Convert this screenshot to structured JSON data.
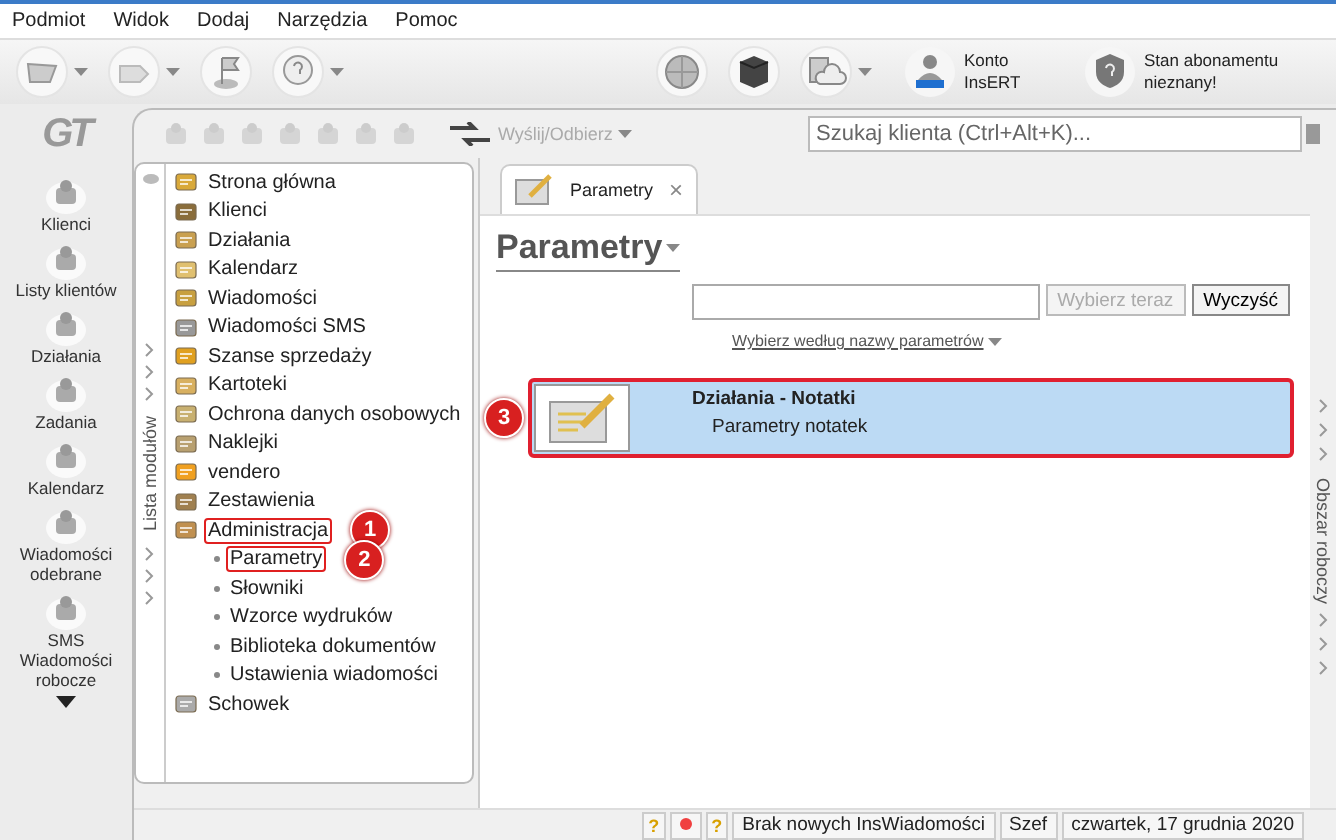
{
  "menu": [
    "Podmiot",
    "Widok",
    "Dodaj",
    "Narzędzia",
    "Pomoc"
  ],
  "account": {
    "label": "Konto InsERT"
  },
  "subscription": {
    "label": "Stan abonamentu nieznany!"
  },
  "logo": "GT",
  "nav": [
    {
      "label": "Klienci"
    },
    {
      "label": "Listy klientów"
    },
    {
      "label": "Działania"
    },
    {
      "label": "Zadania"
    },
    {
      "label": "Kalendarz"
    },
    {
      "label": "Wiadomości odebrane"
    },
    {
      "label": "SMS Wiadomości robocze"
    }
  ],
  "toolbar": {
    "send_receive": "Wyślij/Odbierz",
    "search": {
      "placeholder": "Szukaj klienta (Ctrl+Alt+K)..."
    }
  },
  "module_panel": {
    "title": "Lista modułów",
    "items": [
      {
        "label": "Strona główna",
        "marked": false
      },
      {
        "label": "Klienci",
        "marked": false
      },
      {
        "label": "Działania",
        "marked": false
      },
      {
        "label": "Kalendarz",
        "marked": false
      },
      {
        "label": "Wiadomości",
        "marked": false
      },
      {
        "label": "Wiadomości SMS",
        "marked": false
      },
      {
        "label": "Szanse sprzedaży",
        "marked": false
      },
      {
        "label": "Kartoteki",
        "marked": false
      },
      {
        "label": "Ochrona danych osobowych",
        "marked": false
      },
      {
        "label": "Naklejki",
        "marked": false
      },
      {
        "label": "vendero",
        "marked": false
      },
      {
        "label": "Zestawienia",
        "marked": false
      },
      {
        "label": "Administracja",
        "marked": true,
        "callout": "1",
        "expanded": true,
        "children": [
          {
            "label": "Parametry",
            "marked": true,
            "callout": "2"
          },
          {
            "label": "Słowniki",
            "marked": false
          },
          {
            "label": "Wzorce wydruków",
            "marked": false
          },
          {
            "label": "Biblioteka dokumentów",
            "marked": false
          },
          {
            "label": "Ustawienia wiadomości",
            "marked": false
          }
        ]
      },
      {
        "label": "Schowek",
        "marked": false
      }
    ]
  },
  "tabs": [
    {
      "label": "Parametry",
      "selected": true,
      "close": "×"
    }
  ],
  "heading": "Parametry",
  "filter": {
    "buttons": [
      {
        "label": "Wybierz teraz",
        "disabled": true
      },
      {
        "label": "Wyczyść",
        "disabled": false
      }
    ],
    "link": "Wybierz według nazwy parametrów"
  },
  "results": [
    {
      "title": "Działania - Notatki",
      "subtitle": "Parametry notatek",
      "selected": true,
      "marked": true,
      "callout": "3"
    }
  ],
  "work_area": {
    "title": "Obszar roboczy"
  },
  "status_bar": {
    "indicators": [
      {
        "kind": "help",
        "text": "?"
      },
      {
        "kind": "dot"
      },
      {
        "kind": "help",
        "text": "?"
      }
    ],
    "message": "Brak nowych InsWiadomości",
    "user": "Szef",
    "date": "czwartek, 17 grudnia 2020"
  }
}
